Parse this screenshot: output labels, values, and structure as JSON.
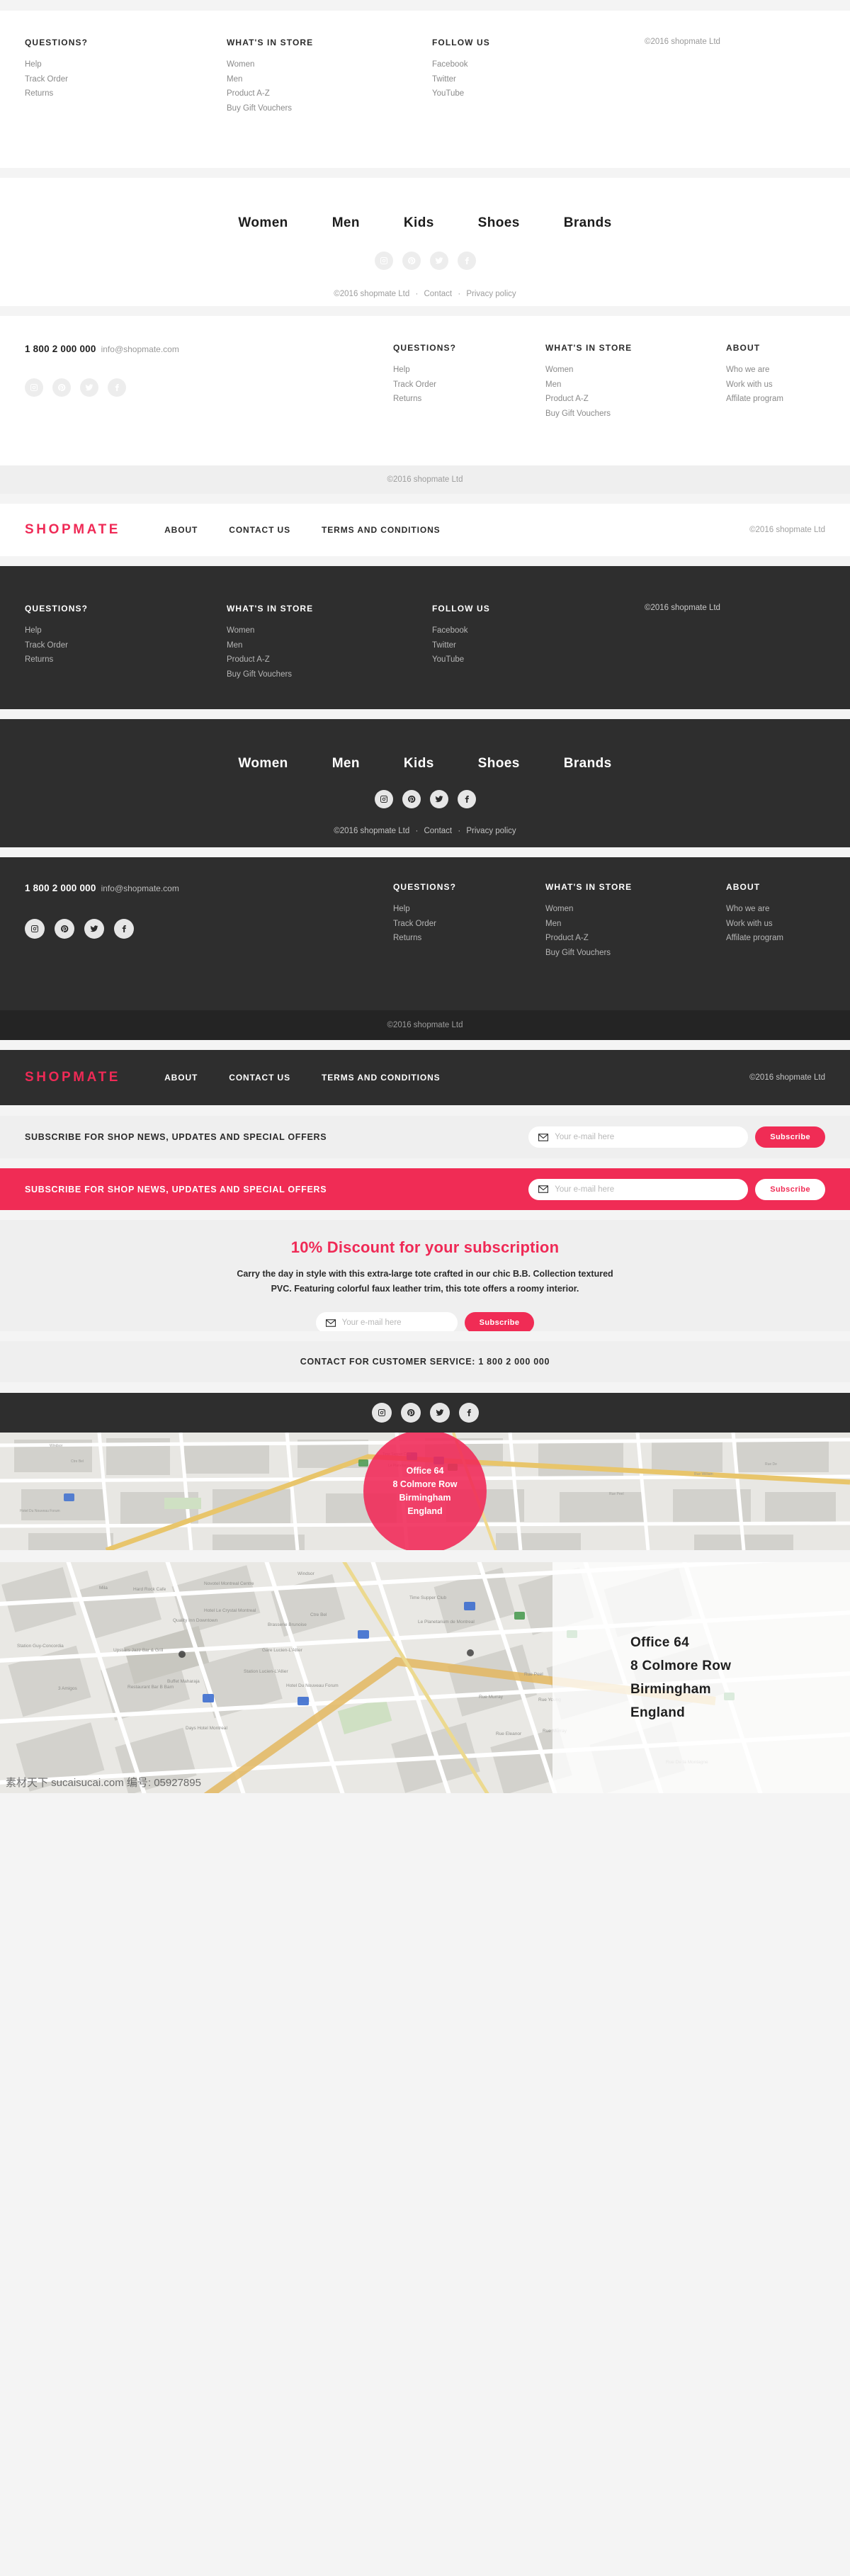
{
  "brand": {
    "name": "SHOPMATE",
    "accent": "#f02c55",
    "dark_bg": "#2e2e2e"
  },
  "copyright": "©2016 shopmate Ltd",
  "columns": {
    "questions": {
      "head": "QUESTIONS?",
      "links": [
        "Help",
        "Track Order",
        "Returns"
      ]
    },
    "store": {
      "head": "WHAT'S IN STORE",
      "links": [
        "Women",
        "Men",
        "Product A-Z",
        "Buy Gift Vouchers"
      ]
    },
    "follow": {
      "head": "FOLLOW US",
      "links": [
        "Facebook",
        "Twitter",
        "YouTube"
      ]
    },
    "about": {
      "head": "ABOUT",
      "links": [
        "Who we are",
        "Work with us",
        "Affilate program"
      ]
    }
  },
  "nav": {
    "items": [
      "Women",
      "Men",
      "Kids",
      "Shoes",
      "Brands"
    ]
  },
  "social": [
    {
      "name": "instagram-icon",
      "label": "Instagram"
    },
    {
      "name": "pinterest-icon",
      "label": "Pinterest"
    },
    {
      "name": "twitter-icon",
      "label": "Twitter"
    },
    {
      "name": "facebook-icon",
      "label": "Facebook"
    }
  ],
  "legal": {
    "copyright": "©2016 shopmate Ltd",
    "contact": "Contact",
    "privacy": "Privacy policy",
    "sep": "·"
  },
  "contact": {
    "phone": "1 800 2 000 000",
    "email": "info@shopmate.com"
  },
  "brandbar": {
    "links": [
      "ABOUT",
      "CONTACT US",
      "TERMS AND CONDITIONS"
    ]
  },
  "subscribe": {
    "title": "SUBSCRIBE FOR SHOP NEWS, UPDATES AND SPECIAL OFFERS",
    "placeholder": "Your e-mail here",
    "button": "Subscribe"
  },
  "promo": {
    "heading": "10% Discount for your subscription",
    "body": "Carry the day in style with this extra-large tote crafted in our chic B.B. Collection textured PVC. Featuring colorful faux leather trim, this tote offers a roomy interior.",
    "placeholder": "Your e-mail here",
    "button": "Subscribe"
  },
  "service": {
    "text": "CONTACT FOR CUSTOMER SERVICE: 1 800 2 000 000"
  },
  "address": {
    "line1": "Office 64",
    "line2": "8 Colmore Row",
    "line3": "Birmingham",
    "line4": "England"
  },
  "watermark": "素材天下 sucaisucai.com 编号: 05927895"
}
